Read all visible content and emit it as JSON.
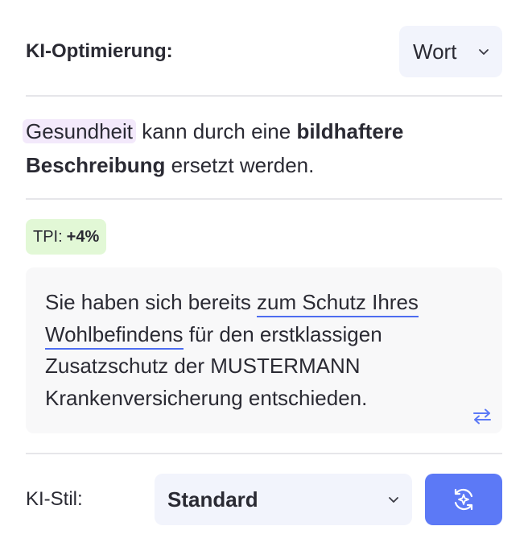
{
  "header": {
    "title": "KI-Optimierung:",
    "mode_value": "Wort"
  },
  "suggestion": {
    "word": "Gesundheit",
    "text_middle": " kann durch eine ",
    "emphasis": "bildhaftere Beschreibung",
    "text_end": " ersetzt werden."
  },
  "tpi": {
    "label": "TPI:",
    "value": "+4%"
  },
  "text_box": {
    "part1": "Sie haben sich bereits ",
    "phrase": "zum Schutz Ihres Wohlbefindens",
    "part2": " für den erstklassigen Zusatzschutz der MUSTERMANN Krankenversicherung entschieden."
  },
  "footer": {
    "style_label": "KI-Stil:",
    "style_value": "Standard"
  },
  "icons": {
    "mode_chevron": "chevron-down-icon",
    "swap": "swap-arrows-icon",
    "style_chevron": "chevron-down-icon",
    "regenerate": "refresh-sparkle-icon"
  },
  "colors": {
    "accent": "#5c79f6",
    "highlight_word_bg": "#f3e9fb",
    "tpi_bg": "#e2f8d6",
    "underline": "#4d6df0",
    "select_bg": "#f2f4fc"
  }
}
